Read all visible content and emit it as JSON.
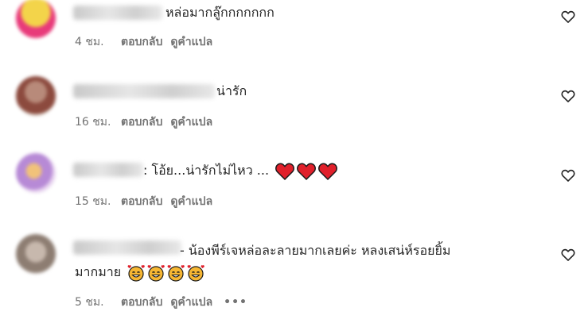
{
  "comments": [
    {
      "text": "หล่อมากลู๊กกกกกกก",
      "time": "4 ชม.",
      "reply": "ตอบกลับ",
      "translate": "ดูคำแปล"
    },
    {
      "text": "น่ารัก",
      "time": "16 ชม.",
      "reply": "ตอบกลับ",
      "translate": "ดูคำแปล"
    },
    {
      "text": ": โอ้ย...น่ารักไม่ไหว ...",
      "time": "15 ชม.",
      "reply": "ตอบกลับ",
      "translate": "ดูคำแปล"
    },
    {
      "text_line1": "- น้องพีร์เจหล่อละลายมากเลยค่ะ หลงเสน่ห์รอยยิ้ม",
      "text_line2": "มากมาย",
      "time": "5 ชม.",
      "reply": "ตอบกลับ",
      "translate": "ดูคำแปล",
      "more": "•••"
    }
  ],
  "icons": {
    "like": "heart-outline-icon",
    "emoji_heart": "red-heart-emoji",
    "emoji_face": "smiling-face-with-hearts-emoji"
  },
  "colors": {
    "text": "#262626",
    "meta": "#737373",
    "heart_emoji": "#e0202b",
    "face_emoji": "#f7b733"
  }
}
